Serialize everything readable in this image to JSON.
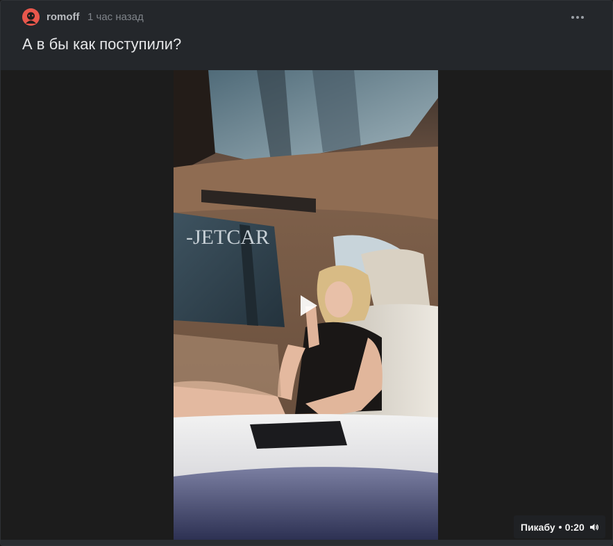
{
  "post": {
    "author": "romoff",
    "time": "1 час назад",
    "title": "А в бы как поступили?"
  },
  "video": {
    "watermark_text": "-JETCAR",
    "source": "Пикабу",
    "duration": "0:20"
  },
  "icons": {
    "avatar": "avatar-icon",
    "more": "more-dots-icon",
    "play": "play-icon",
    "sound": "speaker-icon"
  },
  "colors": {
    "card_bg": "#242629",
    "avatar_bg": "#e8574c",
    "title_text": "#e6e7e9"
  }
}
